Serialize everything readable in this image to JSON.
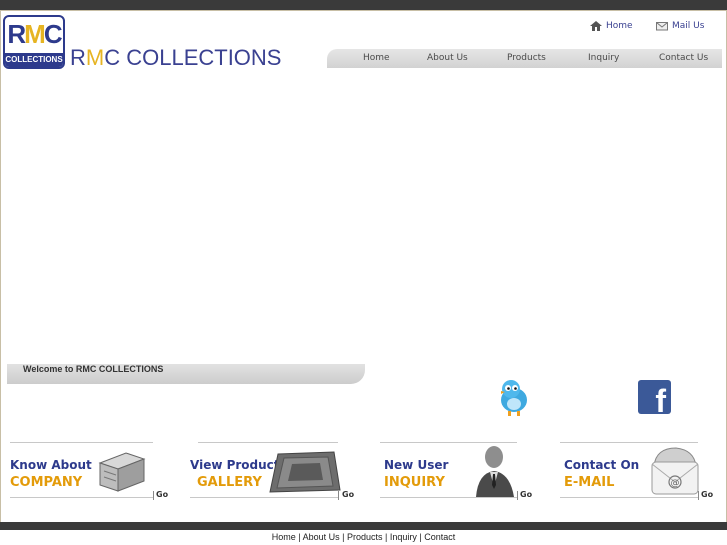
{
  "header": {
    "logo_letters_r": "R",
    "logo_letters_m": "M",
    "logo_letters_c": "C",
    "logo_strip": "COLLECTIONS",
    "brand_r": "R",
    "brand_m": "M",
    "brand_rest": "C COLLECTIONS",
    "top_links": [
      {
        "label": "Home",
        "icon": "home-icon"
      },
      {
        "label": "Mail Us",
        "icon": "mail-icon"
      }
    ]
  },
  "nav": {
    "items": [
      "Home",
      "About Us",
      "Products",
      "Inquiry",
      "Contact Us"
    ]
  },
  "banner": {
    "welcome": "Welcome to RMC COLLECTIONS"
  },
  "social": {
    "twitter": "twitter-bird-icon",
    "facebook": "facebook-icon",
    "facebook_glyph": "f"
  },
  "promos": [
    {
      "line1": "Know About",
      "line2": "COMPANY",
      "go": "Go",
      "icon": "books-icon"
    },
    {
      "line1": "View Product",
      "line2": "GALLERY",
      "go": "Go",
      "icon": "carpet-icon"
    },
    {
      "line1": "New User",
      "line2": "INQUIRY",
      "go": "Go",
      "icon": "businessman-icon"
    },
    {
      "line1": "Contact On",
      "line2": "E-MAIL",
      "go": "Go",
      "icon": "email-envelope-icon"
    }
  ],
  "footer": {
    "links": [
      "Home",
      "About Us",
      "Products",
      "Inquiry",
      "Contact"
    ],
    "separator": " | "
  },
  "colors": {
    "brand_blue": "#2d3a8c",
    "accent_gold": "#e6b422",
    "promo_orange": "#e39b0a",
    "bar_dark": "#3a3a3a"
  }
}
